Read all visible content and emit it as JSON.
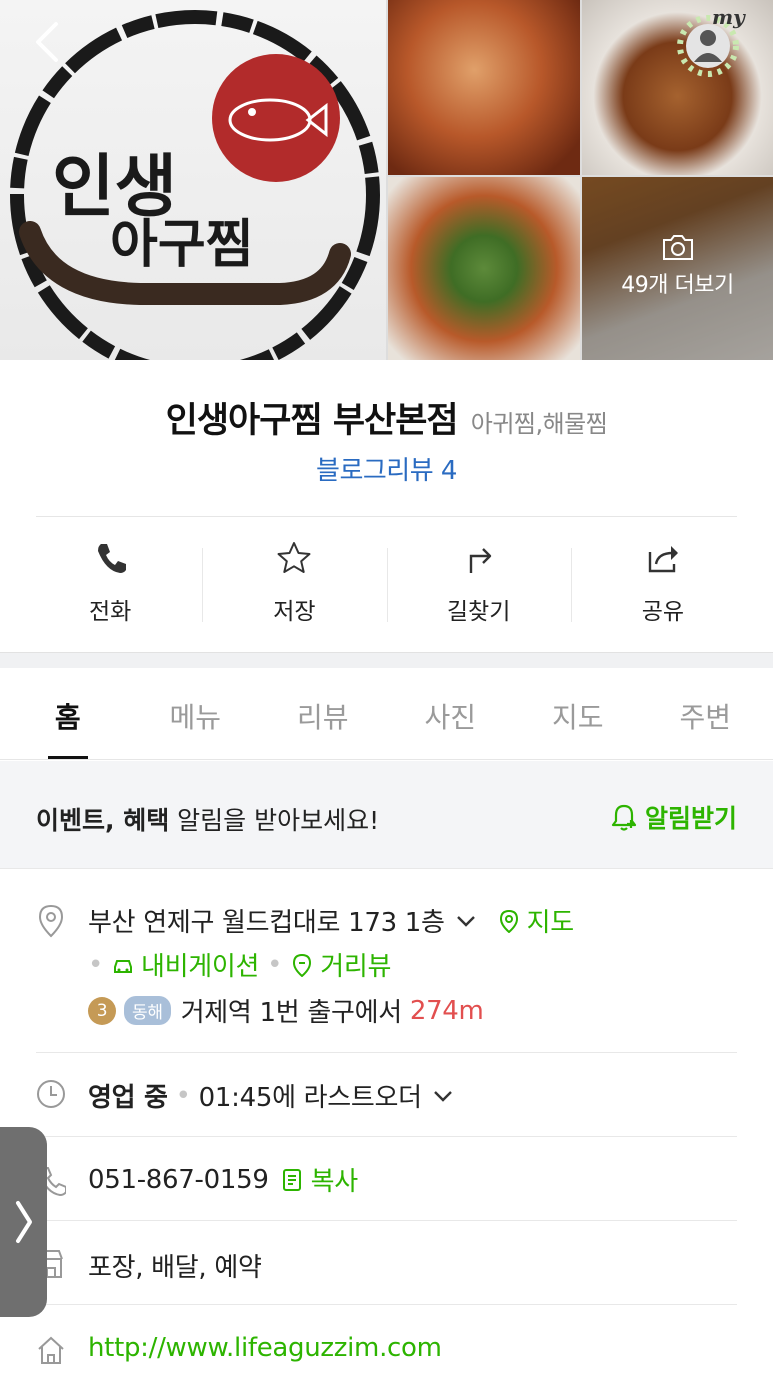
{
  "photos": {
    "logo_text_line1": "인생",
    "logo_text_line2": "아구찜",
    "more_label": "49개 더보기"
  },
  "my_badge": "my",
  "place": {
    "name": "인생아구찜 부산본점",
    "category": "아귀찜,해물찜",
    "blog_review": "블로그리뷰 4"
  },
  "actions": [
    {
      "label": "전화",
      "icon": "phone-icon"
    },
    {
      "label": "저장",
      "icon": "star-icon"
    },
    {
      "label": "길찾기",
      "icon": "directions-icon"
    },
    {
      "label": "공유",
      "icon": "share-icon"
    }
  ],
  "tabs": [
    {
      "label": "홈",
      "active": true
    },
    {
      "label": "메뉴",
      "active": false
    },
    {
      "label": "리뷰",
      "active": false
    },
    {
      "label": "사진",
      "active": false
    },
    {
      "label": "지도",
      "active": false
    },
    {
      "label": "주변",
      "active": false
    }
  ],
  "event": {
    "bold": "이벤트, 혜택",
    "rest": " 알림을 받아보세요!",
    "button": "알림받기"
  },
  "address": {
    "text": "부산 연제구 월드컵대로 173 1층",
    "map_link": "지도",
    "navigation": "내비게이션",
    "street_view": "거리뷰",
    "line_number": "3",
    "line_name": "동해",
    "station": "거제역 1번 출구에서",
    "distance": "274m"
  },
  "hours": {
    "status": "영업 중",
    "detail": "01:45에 라스트오더"
  },
  "phone": {
    "number": "051-867-0159",
    "copy": "복사"
  },
  "services": "포장, 배달, 예약",
  "website": "http://www.lifeaguzzim.com",
  "colors": {
    "accent_green": "#2db400",
    "link_blue": "#2a6bc1",
    "distance_red": "#e24f4f"
  }
}
